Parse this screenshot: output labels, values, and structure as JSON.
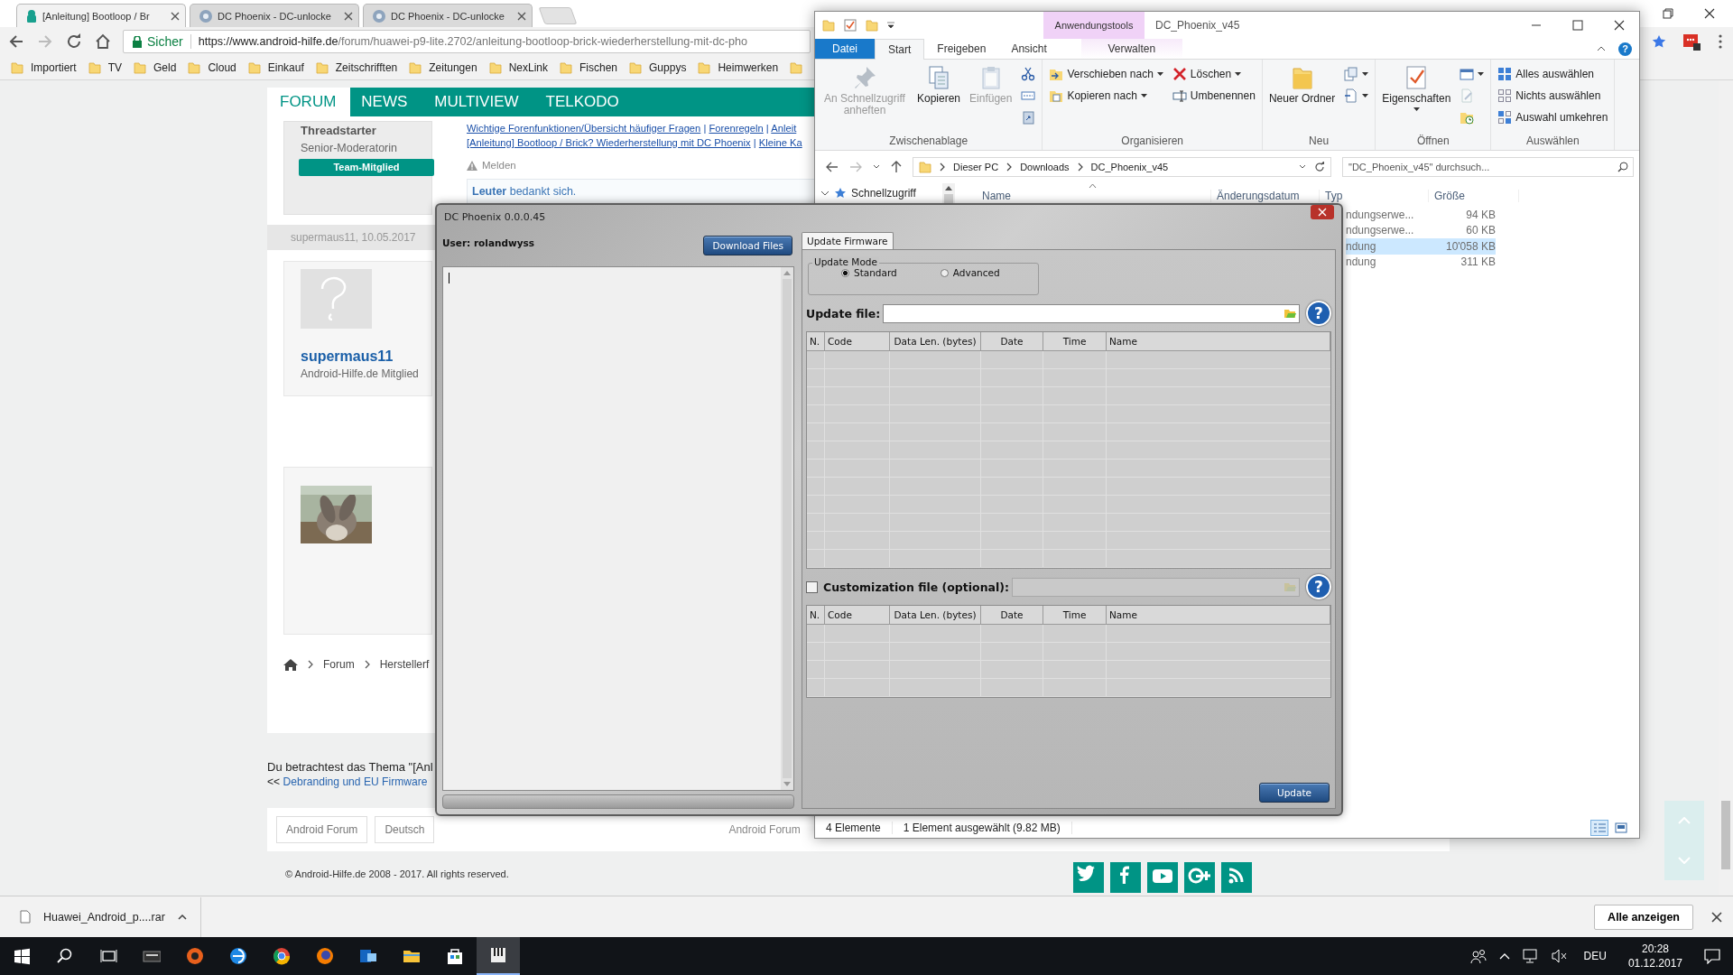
{
  "browser": {
    "tabs": [
      {
        "label": "[Anleitung] Bootloop / Br",
        "kind": "forum",
        "selected": true
      },
      {
        "label": "DC Phoenix - DC-unlocke",
        "kind": "tool",
        "selected": false
      },
      {
        "label": "DC Phoenix - DC-unlocke",
        "kind": "tool",
        "selected": false
      }
    ],
    "security_label": "Sicher",
    "url_host": "https://www.android-hilfe.de",
    "url_path": "/forum/huawei-p9-lite.2702/anleitung-bootloop-brick-wiederherstellung-mit-dc-pho",
    "bookmarks": [
      "Importiert",
      "TV",
      "Geld",
      "Cloud",
      "Einkauf",
      "Zeitschrifften",
      "Zeitungen",
      "NexLink",
      "Fischen",
      "Guppys",
      "Heimwerken"
    ]
  },
  "forum": {
    "nav": [
      {
        "label": "FORUM",
        "selected": true
      },
      {
        "label": "NEWS",
        "selected": false
      },
      {
        "label": "MULTIVIEW",
        "selected": false
      },
      {
        "label": "TELKODO",
        "selected": false
      }
    ],
    "post_author": {
      "role": "Threadstarter",
      "rank": "Senior-Moderatorin",
      "badge": "Team-Mitglied"
    },
    "signature_lines": [
      {
        "separator": "|",
        "links": [
          "Wichtige Forenfunktionen/Übersicht häufiger Fragen",
          "Forenregeln",
          "Anleit"
        ]
      },
      {
        "separator": "|",
        "links": [
          "[Anleitung] Bootloop / Brick? Wiederherstellung mit DC Phoenix",
          "Kleine Ka"
        ]
      }
    ],
    "report": "Melden",
    "thanks": {
      "user": "Leuter",
      "text": "bedankt sich."
    },
    "reply": {
      "header": "supermaus11, 10.05.2017",
      "username": "supermaus11",
      "rank": "Android-Hilfe.de Mitglied"
    },
    "breadcrumb": [
      "Forum",
      "Herstellerf"
    ],
    "viewing": "Du betrachtest das Thema \"[Anl",
    "prev_thread": {
      "prefix": "<<",
      "title": "Debranding und EU Firmware"
    },
    "footer_buttons": [
      "Android Forum",
      "Deutsch"
    ],
    "footer_link": "Android Forum",
    "copyright": "© Android-Hilfe.de 2008 - 2017. All rights reserved."
  },
  "explorer": {
    "title": "DC_Phoenix_v45",
    "context_tab": "Anwendungstools",
    "help": "?",
    "ribbon_tabs": [
      {
        "label": "Datei",
        "kind": "file",
        "selected": false
      },
      {
        "label": "Start",
        "kind": "tab",
        "selected": true
      },
      {
        "label": "Freigeben",
        "kind": "tab",
        "selected": false
      },
      {
        "label": "Ansicht",
        "kind": "tab",
        "selected": false
      },
      {
        "label": "Verwalten",
        "kind": "context",
        "selected": false
      }
    ],
    "ribbon_groups": [
      {
        "label": "Zwischenablage",
        "columns": [
          {
            "kind": "large",
            "commands": [
              {
                "kind": "pin",
                "label": "An Schnellzugriff anheften",
                "dropdown": false,
                "disabled": true
              }
            ]
          },
          {
            "kind": "large",
            "commands": [
              {
                "kind": "copy",
                "label": "Kopieren",
                "dropdown": false,
                "disabled": false
              }
            ]
          },
          {
            "kind": "large",
            "commands": [
              {
                "kind": "paste",
                "label": "Einfügen",
                "dropdown": false,
                "disabled": true
              }
            ]
          },
          {
            "kind": "stack",
            "commands": [
              {
                "kind": "cut",
                "dropdown": false,
                "disabled": false
              },
              {
                "kind": "copy_path",
                "dropdown": false,
                "disabled": false
              },
              {
                "kind": "paste_shortcut",
                "dropdown": false,
                "disabled": false
              }
            ]
          }
        ]
      },
      {
        "label": "Organisieren",
        "columns": [
          {
            "kind": "stack",
            "commands": [
              {
                "kind": "move",
                "label": "Verschieben nach",
                "dropdown": true,
                "disabled": false
              },
              {
                "kind": "copy_to",
                "label": "Kopieren nach",
                "dropdown": true,
                "disabled": false
              }
            ]
          },
          {
            "kind": "stack",
            "commands": [
              {
                "kind": "delete",
                "label": "Löschen",
                "dropdown": true,
                "disabled": false
              },
              {
                "kind": "rename",
                "label": "Umbenennen",
                "dropdown": false,
                "disabled": false
              }
            ]
          }
        ]
      },
      {
        "label": "Neu",
        "columns": [
          {
            "kind": "large",
            "commands": [
              {
                "kind": "new_folder",
                "label": "Neuer Ordner",
                "dropdown": false,
                "disabled": false
              }
            ]
          },
          {
            "kind": "stack",
            "commands": [
              {
                "kind": "new_item",
                "dropdown": true,
                "disabled": false
              },
              {
                "kind": "easy_access",
                "dropdown": true,
                "disabled": false
              }
            ]
          }
        ]
      },
      {
        "label": "Öffnen",
        "columns": [
          {
            "kind": "large",
            "commands": [
              {
                "kind": "properties",
                "label": "Eigenschaften",
                "dropdown": true,
                "disabled": false
              }
            ]
          },
          {
            "kind": "stack",
            "commands": [
              {
                "kind": "open",
                "dropdown": true,
                "disabled": false
              },
              {
                "kind": "edit",
                "dropdown": false,
                "disabled": true
              },
              {
                "kind": "history",
                "dropdown": false,
                "disabled": false
              }
            ]
          }
        ]
      },
      {
        "label": "Auswählen",
        "columns": [
          {
            "kind": "stack",
            "commands": [
              {
                "kind": "select_all",
                "label": "Alles auswählen",
                "dropdown": false,
                "disabled": false
              },
              {
                "kind": "select_none",
                "label": "Nichts auswählen",
                "dropdown": false,
                "disabled": false
              },
              {
                "kind": "invert",
                "label": "Auswahl umkehren",
                "dropdown": false,
                "disabled": false
              }
            ]
          }
        ]
      }
    ],
    "path": [
      "Dieser PC",
      "Downloads",
      "DC_Phoenix_v45"
    ],
    "search": {
      "placeholder": "\"DC_Phoenix_v45\" durchsuch..."
    },
    "nav_items": [
      {
        "label": "Schnellzugriff",
        "expanded": true
      }
    ],
    "columns": [
      "Name",
      "Änderungsdatum",
      "Typ",
      "Größe"
    ],
    "files": [
      {
        "type": "ndungserwe...",
        "size": "94 KB",
        "selected": false
      },
      {
        "type": "ndungserwe...",
        "size": "60 KB",
        "selected": false
      },
      {
        "type": "ndung",
        "size": "10'058 KB",
        "selected": true
      },
      {
        "type": "ndung",
        "size": "311 KB",
        "selected": false
      }
    ],
    "status": [
      "4 Elemente",
      "1 Element ausgewählt (9.82 MB)"
    ],
    "view_modes": [
      {
        "selected": true
      },
      {
        "selected": false
      }
    ]
  },
  "phoenix": {
    "title": "DC Phoenix 0.0.0.45",
    "user": "User: rolandwyss",
    "download_button": "Download Files",
    "tabs": [
      {
        "label": "Update Firmware",
        "selected": true
      }
    ],
    "update_mode": {
      "label": "Update Mode",
      "options": [
        {
          "label": "Standard",
          "selected": true
        },
        {
          "label": "Advanced",
          "selected": false
        }
      ]
    },
    "update_file": {
      "label": "Update file:",
      "help": "?"
    },
    "table_columns": [
      "N.",
      "Code",
      "Data Len. (bytes)",
      "Date",
      "Time",
      "Name"
    ],
    "customization": {
      "label": "Customization file (optional):",
      "checked": false,
      "help": "?"
    },
    "custom_table_columns": [
      "N.",
      "Code",
      "Data Len. (bytes)",
      "Date",
      "Time",
      "Name"
    ],
    "update_button": "Update"
  },
  "downloads": {
    "file": "Huawei_Android_p....rar",
    "show_all": "Alle anzeigen"
  },
  "taskbar": {
    "language": "DEU",
    "time": "20:28",
    "date": "01.12.2017"
  }
}
